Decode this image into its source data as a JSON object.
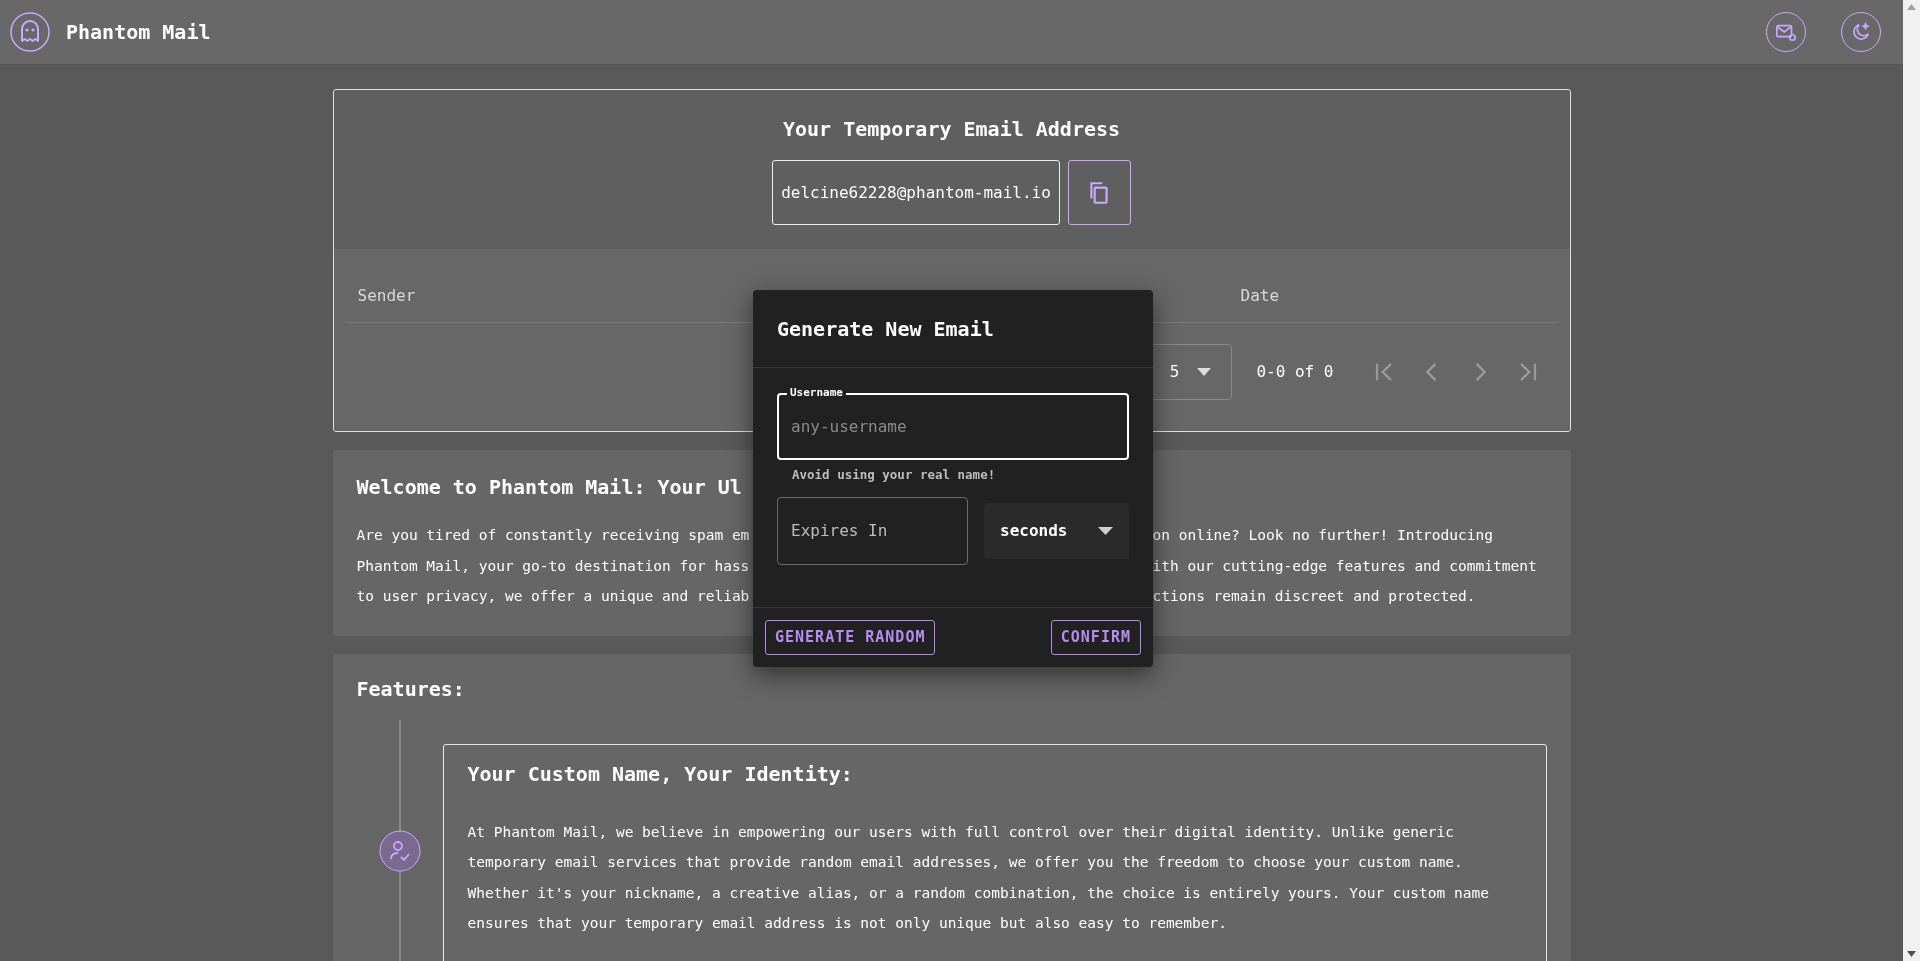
{
  "app": {
    "title": "Phantom Mail"
  },
  "address_card": {
    "title": "Your Temporary Email Address",
    "email": "delcine62228@phantom-mail.io"
  },
  "table": {
    "columns": [
      "Sender",
      "Date"
    ],
    "pagination": {
      "rows_per_page": "5",
      "range": "0-0 of 0"
    }
  },
  "welcome": {
    "title": "Welcome to Phantom Mail: Your Ul",
    "lines": [
      {
        "left": "Are you tired of constantly receiving spam em",
        "right": "on online? Look no further! Introducing"
      },
      {
        "left": "Phantom Mail, your go-to destination for hass",
        "right": "ith our cutting-edge features and commitment"
      },
      {
        "left": "to user privacy, we offer a unique and reliab",
        "right": "ctions remain discreet and protected."
      }
    ]
  },
  "features": {
    "title": "Features:",
    "items": [
      {
        "title": "Your Custom Name, Your Identity:",
        "text": "At Phantom Mail, we believe in empowering our users with full control over their digital identity. Unlike generic temporary email services that provide random email addresses, we offer you the freedom to choose your custom name. Whether it's your nickname, a creative alias, or a random combination, the choice is entirely yours. Your custom name ensures that your temporary email address is not only unique but also easy to remember."
      }
    ]
  },
  "dialog": {
    "title": "Generate New Email",
    "username": {
      "label": "Username",
      "placeholder": "any-username",
      "helper": "Avoid using your real name!"
    },
    "expires": {
      "placeholder": "Expires In"
    },
    "unit": {
      "value": "seconds"
    },
    "buttons": [
      "GENERATE RANDOM",
      "CONFIRM"
    ]
  }
}
